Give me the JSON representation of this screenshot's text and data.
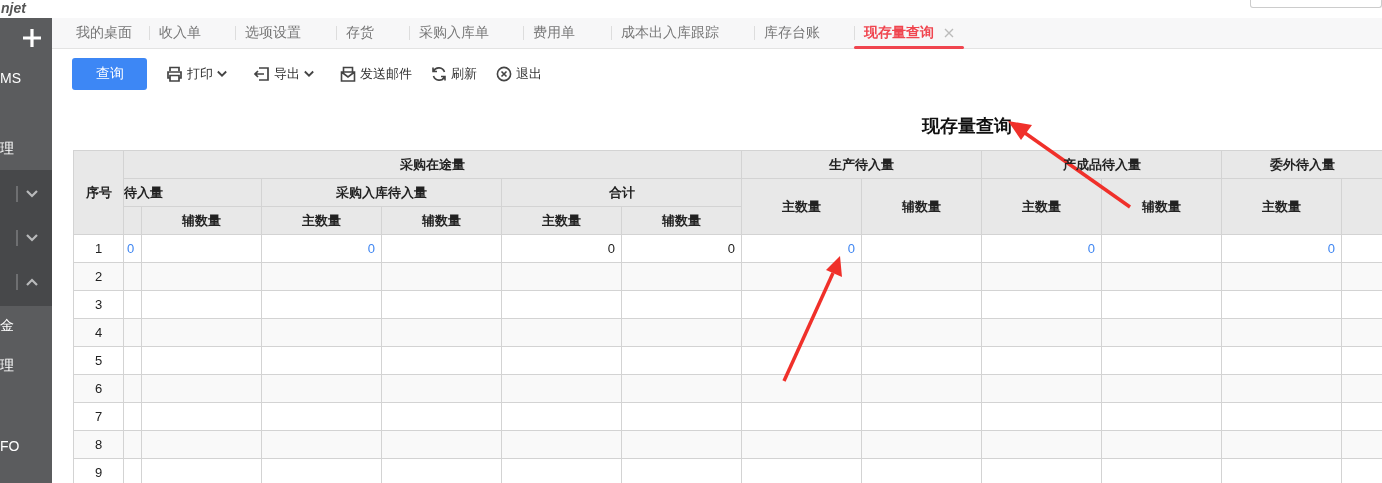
{
  "logo": "njet",
  "sidebar": {
    "items": [
      {
        "kind": "text",
        "label": "MS"
      },
      {
        "kind": "text",
        "label": "理"
      },
      {
        "kind": "group",
        "expanded": false
      },
      {
        "kind": "group",
        "expanded": false
      },
      {
        "kind": "group",
        "expanded": true
      },
      {
        "kind": "text",
        "label": "金"
      },
      {
        "kind": "text",
        "label": "理"
      },
      {
        "kind": "text",
        "label": "FO"
      }
    ]
  },
  "tabs": [
    {
      "label": "我的桌面",
      "selected": false
    },
    {
      "label": "收入单",
      "selected": false
    },
    {
      "label": "选项设置",
      "selected": false
    },
    {
      "label": "存货",
      "selected": false
    },
    {
      "label": "采购入库单",
      "selected": false
    },
    {
      "label": "费用单",
      "selected": false
    },
    {
      "label": "成本出入库跟踪",
      "selected": false
    },
    {
      "label": "库存台账",
      "selected": false
    },
    {
      "label": "现存量查询",
      "selected": true,
      "closable": true
    }
  ],
  "toolbar": [
    {
      "kind": "primary",
      "label": "查询"
    },
    {
      "kind": "print",
      "label": "打印",
      "menu": true
    },
    {
      "kind": "export",
      "label": "导出",
      "menu": true
    },
    {
      "kind": "mail",
      "label": "发送邮件"
    },
    {
      "kind": "refresh",
      "label": "刷新"
    },
    {
      "kind": "exit",
      "label": "退出"
    }
  ],
  "report": {
    "title": "现存量查询",
    "header_rows": [
      [
        {
          "text": "序号",
          "rowspan": 3
        },
        {
          "text": "采购在途量",
          "colspan": 6
        },
        {
          "text": "生产待入量",
          "colspan": 2
        },
        {
          "text": "产成品待入量",
          "colspan": 2
        },
        {
          "text": "委外待入量",
          "colspan": 2
        }
      ],
      [
        {
          "text": "待入量",
          "colspan": 2
        },
        {
          "text": "采购入库待入量",
          "colspan": 2
        },
        {
          "text": "合计",
          "colspan": 2
        },
        {
          "text": "主数量",
          "rowspan": 2
        },
        {
          "text": "辅数量",
          "rowspan": 2
        },
        {
          "text": "主数量",
          "rowspan": 2
        },
        {
          "text": "辅数量",
          "rowspan": 2
        },
        {
          "text": "主数量",
          "rowspan": 2
        },
        {
          "rowspan": 2
        }
      ],
      [
        {},
        {
          "text": "辅数量"
        },
        {
          "text": "主数量"
        },
        {
          "text": "辅数量"
        },
        {
          "text": "主数量"
        },
        {
          "text": "辅数量"
        }
      ]
    ],
    "rows": [
      {
        "index": "1",
        "cells": [
          {
            "text": "0",
            "kind": "link"
          },
          null,
          {
            "text": "0",
            "kind": "link"
          },
          null,
          {
            "text": "0",
            "kind": "plain"
          },
          {
            "text": "0",
            "kind": "plain"
          },
          {
            "text": "0",
            "kind": "link"
          },
          null,
          {
            "text": "0",
            "kind": "link"
          },
          null,
          {
            "text": "0",
            "kind": "link"
          },
          null,
          null
        ]
      },
      {
        "index": "2",
        "cells": []
      },
      {
        "index": "3",
        "cells": []
      },
      {
        "index": "4",
        "cells": []
      },
      {
        "index": "5",
        "cells": []
      },
      {
        "index": "6",
        "cells": []
      },
      {
        "index": "7",
        "cells": []
      },
      {
        "index": "8",
        "cells": []
      },
      {
        "index": "9",
        "cells": []
      }
    ]
  }
}
